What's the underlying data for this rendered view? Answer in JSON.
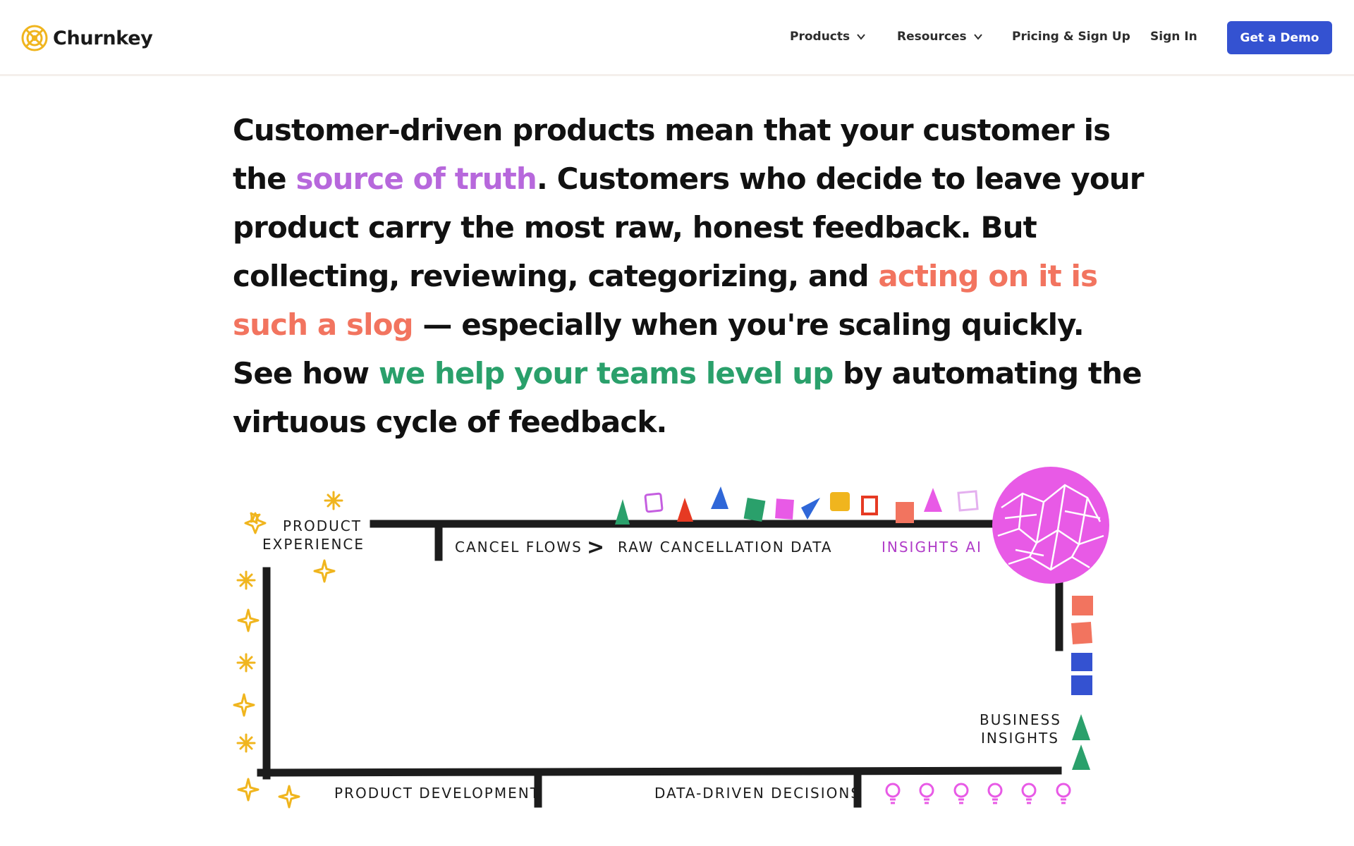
{
  "nav": {
    "brand": "Churnkey",
    "products": "Products",
    "resources": "Resources",
    "pricing": "Pricing & Sign Up",
    "sign_in": "Sign In",
    "cta": "Get a Demo"
  },
  "intro": {
    "p1": "Customer-driven products mean that your customer is the ",
    "h1": "source of truth",
    "p2": ". Customers who decide to leave your product carry the most raw, honest feedback. But collecting, reviewing, categorizing, and ",
    "h2": "acting on it is such a slog",
    "p3": " — especially when you're scaling quickly. See how ",
    "h3": "we help your teams level up",
    "p4": " by automating the virtuous cycle of feedback."
  },
  "diagram": {
    "product_experience_1": "PRODUCT",
    "product_experience_2": "EXPERIENCE",
    "cancel_flows": "CANCEL FLOWS",
    "arrow": ">",
    "raw_data": "RAW CANCELLATION DATA",
    "insights_ai": "INSIGHTS AI",
    "business_insights_1": "BUSINESS",
    "business_insights_2": "INSIGHTS",
    "product_development": "PRODUCT DEVELOPMENT",
    "data_driven": "DATA-DRIVEN DECISIONS"
  },
  "colors": {
    "accent_blue": "#3452d1",
    "purple": "#b768dc",
    "coral": "#f2745f",
    "green": "#2aa06b",
    "magenta": "#e85ae6",
    "star": "#f0b51e",
    "line": "#1c1c1c"
  },
  "icons": [
    "logo-icon",
    "chevron-down-icon",
    "sparkle-icon",
    "asterisk-icon",
    "lightbulb-icon",
    "brain-icon"
  ]
}
